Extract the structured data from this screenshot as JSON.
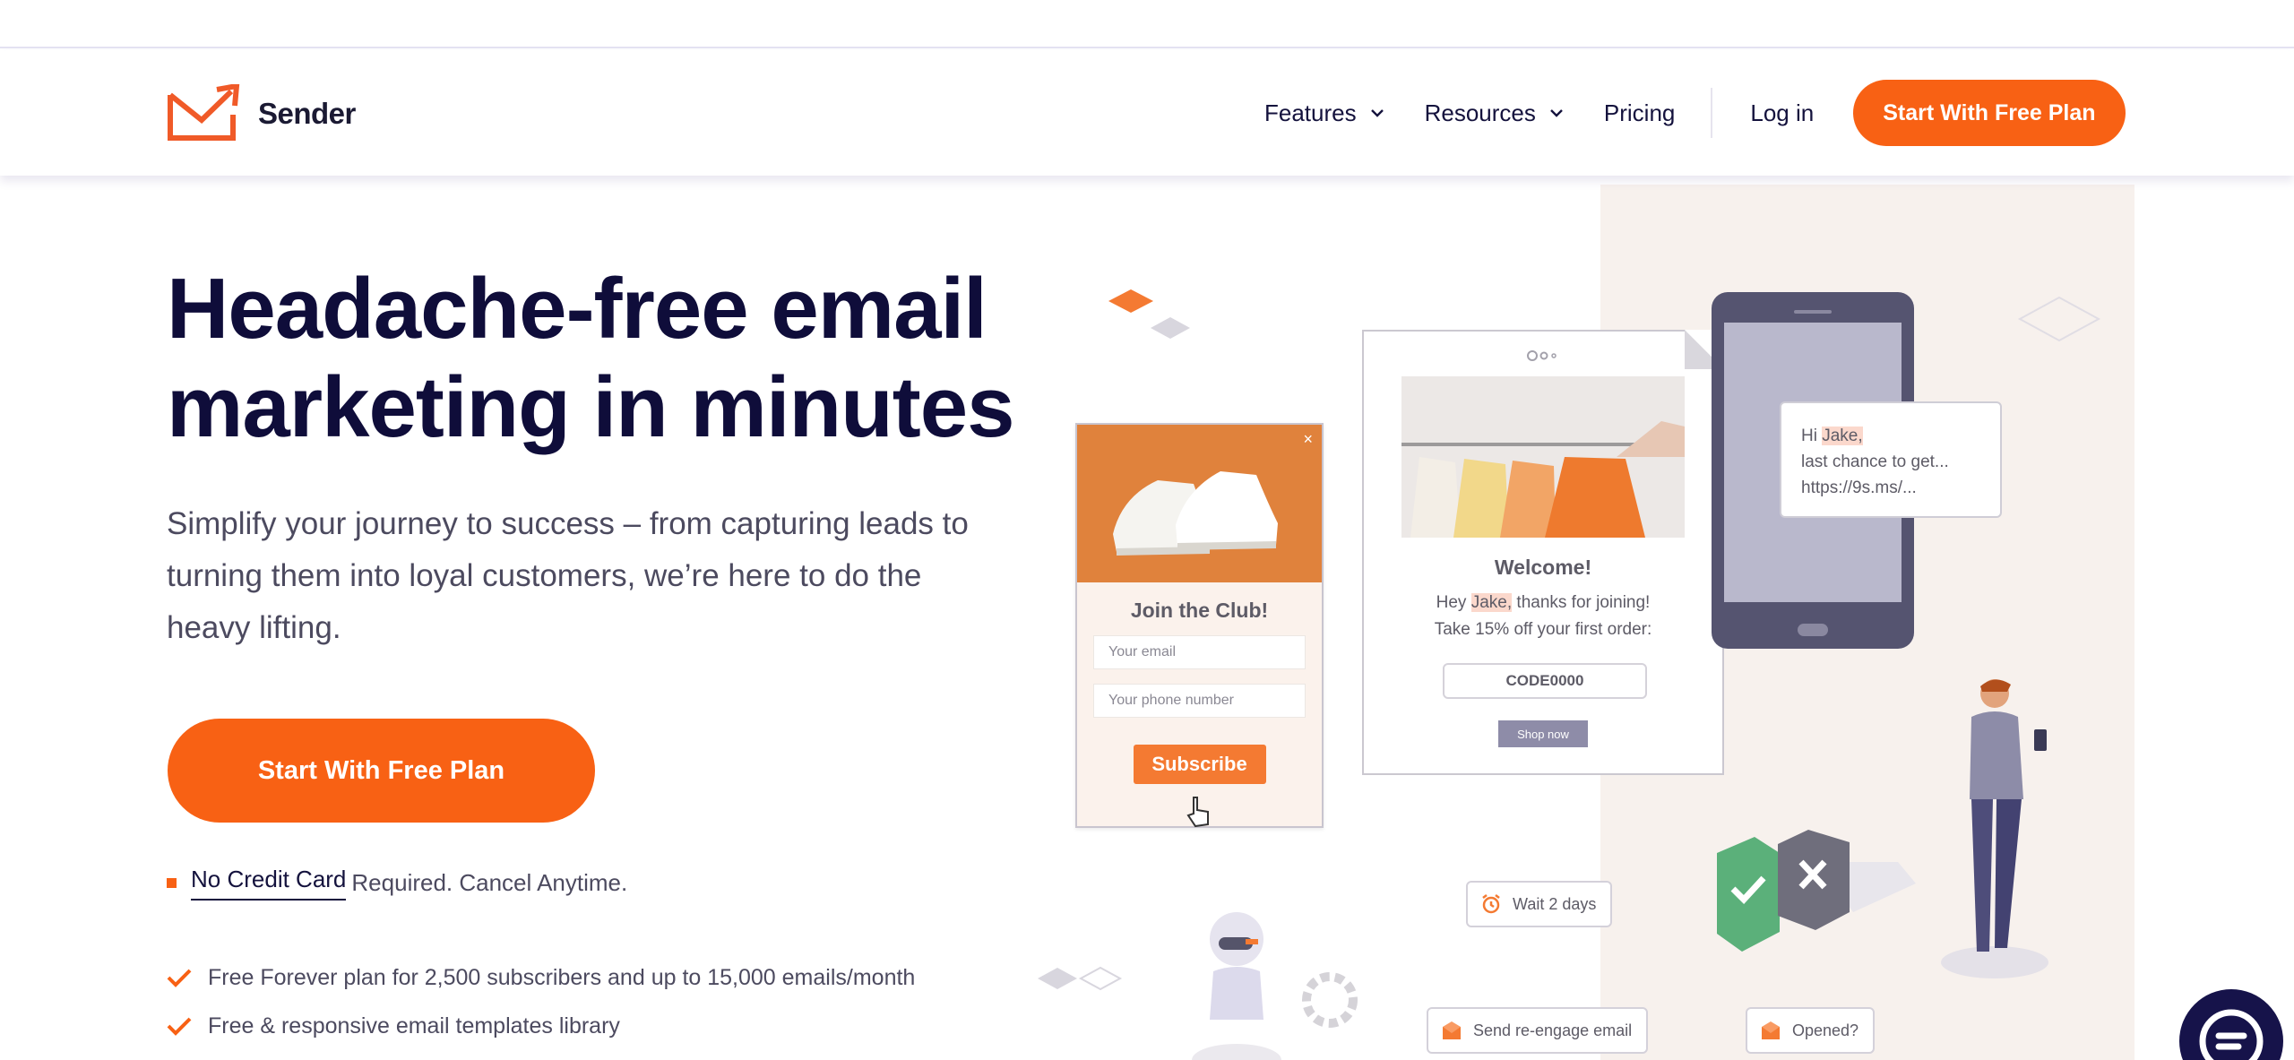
{
  "header": {
    "logo_text": "Sender",
    "nav": [
      {
        "label": "Features",
        "has_dropdown": true
      },
      {
        "label": "Resources",
        "has_dropdown": true
      },
      {
        "label": "Pricing",
        "has_dropdown": false
      }
    ],
    "login_label": "Log in",
    "cta_label": "Start With Free Plan"
  },
  "hero": {
    "title_line1": "Headache-free email",
    "title_line2": "marketing in minutes",
    "subtitle": "Simplify your journey to success – from capturing leads to turning them into loyal customers, we’re here to do the heavy lifting.",
    "cta_label": "Start With Free Plan",
    "no_cc_highlight": "No Credit Card",
    "no_cc_rest": "Required. Cancel Anytime.",
    "features": [
      "Free Forever plan for 2,500 subscribers and up to 15,000 emails/month",
      "Free & responsive email templates library"
    ]
  },
  "illustration": {
    "popup": {
      "close": "×",
      "title": "Join the Club!",
      "email_placeholder": "Your email",
      "phone_placeholder": "Your phone number",
      "button": "Subscribe"
    },
    "email_card": {
      "welcome": "Welcome!",
      "msg_hey": "Hey ",
      "msg_name": "Jake,",
      "msg_rest": " thanks for joining!",
      "msg_line2": "Take 15% off your first order:",
      "code": "CODE0000",
      "shop_button": "Shop now"
    },
    "sms": {
      "hi": "Hi ",
      "name": "Jake,",
      "line2": "last chance to get...",
      "line3": "https://9s.ms/..."
    },
    "chips": {
      "wait": "Wait 2 days",
      "reengage": "Send re-engage email",
      "opened": "Opened?"
    }
  },
  "colors": {
    "brand_orange": "#f86114",
    "navy": "#0f0d3a",
    "muted_text": "#4c4a5f"
  }
}
